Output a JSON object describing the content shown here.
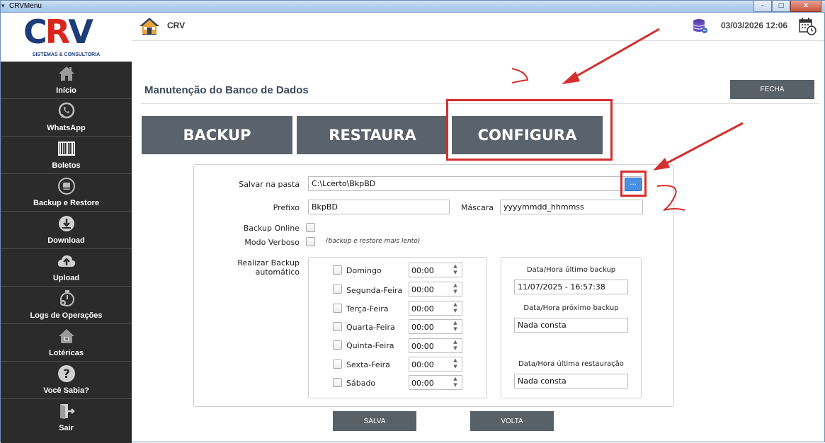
{
  "window": {
    "title": "CRVMenu",
    "minimize": "–",
    "maximize": "□",
    "close": "x"
  },
  "logo": {
    "mark_c": "C",
    "mark_r": "R",
    "mark_v": "V",
    "subtitle": "SISTEMAS & CONSULTORIA"
  },
  "sidebar": {
    "items": [
      {
        "label": "Início",
        "icon": "home-icon"
      },
      {
        "label": "WhatsApp",
        "icon": "whatsapp-icon"
      },
      {
        "label": "Boletos",
        "icon": "barcode-icon"
      },
      {
        "label": "Backup e Restore",
        "icon": "backup-icon"
      },
      {
        "label": "Download",
        "icon": "download-icon"
      },
      {
        "label": "Upload",
        "icon": "upload-icon"
      },
      {
        "label": "Logs de Operações",
        "icon": "logs-icon"
      },
      {
        "label": "Lotéricas",
        "icon": "lottery-icon"
      },
      {
        "label": "Você Sabia?",
        "icon": "question-icon"
      },
      {
        "label": "Sair",
        "icon": "exit-icon"
      }
    ]
  },
  "header": {
    "app_name": "CRV",
    "datetime": "03/03/2026 12:06"
  },
  "page": {
    "title": "Manutenção do Banco de Dados",
    "close_button": "FECHA",
    "tabs": [
      "BACKUP",
      "RESTAURA",
      "CONFIGURA"
    ]
  },
  "form": {
    "save_folder_label": "Salvar na pasta",
    "save_folder_value": "C:\\Lcerto\\BkpBD",
    "browse_button": "...",
    "prefix_label": "Prefixo",
    "prefix_value": "BkpBD",
    "mask_label": "Máscara",
    "mask_value": "yyyymmdd_hhmmss",
    "backup_online_label": "Backup Online",
    "verbose_label": "Modo Verboso",
    "verbose_note": "(backup e restore mais lento)",
    "auto_backup_label": "Realizar Backup automático",
    "days": [
      {
        "name": "Domingo",
        "time": "00:00"
      },
      {
        "name": "Segunda-Feira",
        "time": "00:00"
      },
      {
        "name": "Terça-Feira",
        "time": "00:00"
      },
      {
        "name": "Quarta-Feira",
        "time": "00:00"
      },
      {
        "name": "Quinta-Feira",
        "time": "00:00"
      },
      {
        "name": "Sexta-Feira",
        "time": "00:00"
      },
      {
        "name": "Sábado",
        "time": "00:00"
      }
    ],
    "last_backup_label": "Data/Hora último backup",
    "last_backup_value": "11/07/2025 - 16:57:38",
    "next_backup_label": "Data/Hora próximo backup",
    "next_backup_value": "Nada consta",
    "last_restore_label": "Data/Hora última restauração",
    "last_restore_value": "Nada consta"
  },
  "actions": {
    "save": "SALVA",
    "back": "VOLTA"
  },
  "colors": {
    "sidebar_bg": "#2b2b2b",
    "button_bg": "#586068",
    "annotation": "#d32f2f",
    "browse_btn": "#4a90e2"
  }
}
